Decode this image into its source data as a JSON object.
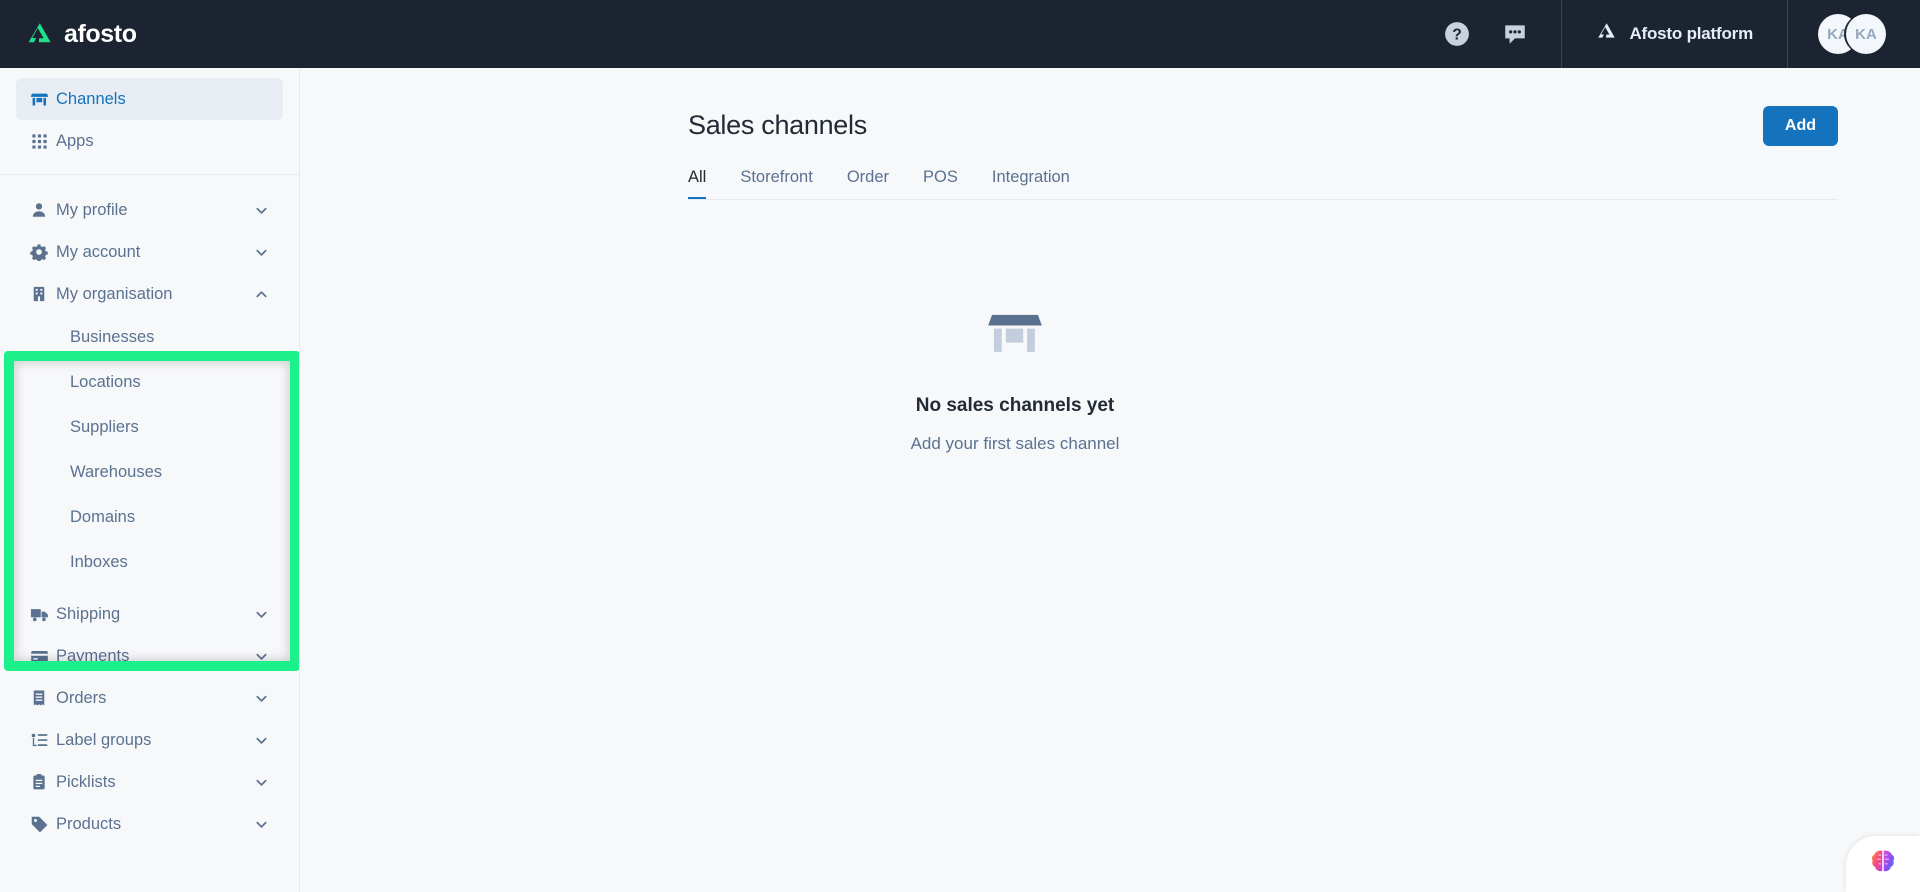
{
  "topbar": {
    "brand_name": "afosto",
    "brand_logo_icon": "afosto-logo-icon",
    "help_icon": "help-circle-icon",
    "chat_icon": "chat-bubble-icon",
    "platform_label": "Afosto platform",
    "platform_icon": "afosto-mark-icon",
    "avatars": [
      {
        "initials": "KA"
      },
      {
        "initials": "KA"
      }
    ]
  },
  "sidebar": {
    "primary": [
      {
        "label": "Channels",
        "icon": "store-icon",
        "active": true
      },
      {
        "label": "Apps",
        "icon": "grid-icon",
        "active": false
      }
    ],
    "groups": [
      {
        "label": "My profile",
        "icon": "user-icon",
        "expanded": false,
        "chevron": "chevron-down-icon"
      },
      {
        "label": "My account",
        "icon": "gear-icon",
        "expanded": false,
        "chevron": "chevron-down-icon"
      },
      {
        "label": "My organisation",
        "icon": "building-icon",
        "expanded": true,
        "chevron": "chevron-up-icon",
        "children": [
          {
            "label": "Businesses"
          },
          {
            "label": "Locations"
          },
          {
            "label": "Suppliers"
          },
          {
            "label": "Warehouses"
          },
          {
            "label": "Domains"
          },
          {
            "label": "Inboxes"
          }
        ]
      },
      {
        "label": "Shipping",
        "icon": "truck-icon",
        "expanded": false,
        "chevron": "chevron-down-icon"
      },
      {
        "label": "Payments",
        "icon": "credit-card-icon",
        "expanded": false,
        "chevron": "chevron-down-icon"
      },
      {
        "label": "Orders",
        "icon": "receipt-icon",
        "expanded": false,
        "chevron": "chevron-down-icon"
      },
      {
        "label": "Label groups",
        "icon": "label-list-icon",
        "expanded": false,
        "chevron": "chevron-down-icon"
      },
      {
        "label": "Picklists",
        "icon": "clipboard-icon",
        "expanded": false,
        "chevron": "chevron-down-icon"
      },
      {
        "label": "Products",
        "icon": "tag-icon",
        "expanded": false,
        "chevron": "chevron-down-icon"
      }
    ]
  },
  "main": {
    "title": "Sales channels",
    "add_label": "Add",
    "tabs": [
      {
        "label": "All",
        "active": true
      },
      {
        "label": "Storefront",
        "active": false
      },
      {
        "label": "Order",
        "active": false
      },
      {
        "label": "POS",
        "active": false
      },
      {
        "label": "Integration",
        "active": false
      }
    ],
    "empty_state": {
      "icon": "store-icon",
      "title": "No sales channels yet",
      "subtitle": "Add your first sales channel"
    }
  },
  "widgets": {
    "assistant": {
      "icon": "brain-icon"
    }
  },
  "colors": {
    "topbar_bg": "#1b2430",
    "accent_blue": "#1573be",
    "brand_green": "#20e08a",
    "highlight_green": "#1cf08a",
    "text_slate": "#5a7290",
    "page_bg": "#f7f8fa"
  }
}
